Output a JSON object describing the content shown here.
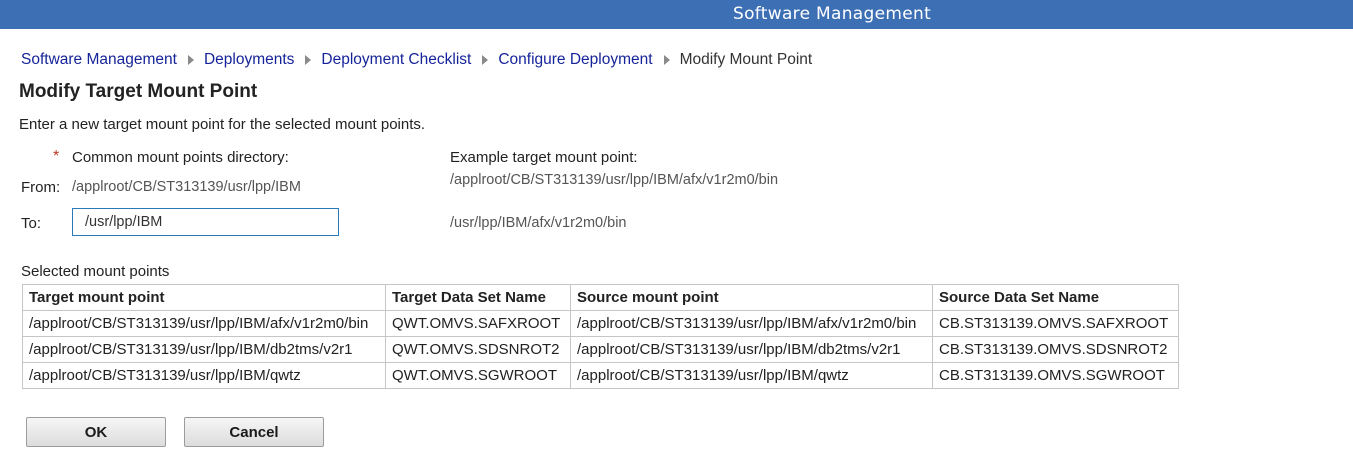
{
  "header": {
    "title": "Software Management"
  },
  "breadcrumb": {
    "links": [
      "Software Management",
      "Deployments",
      "Deployment Checklist",
      "Configure Deployment"
    ],
    "current": "Modify Mount Point"
  },
  "page": {
    "title": "Modify Target Mount Point",
    "instructions": "Enter a new target mount point for the selected mount points."
  },
  "form": {
    "required_marker": "*",
    "common_label": "Common mount points directory:",
    "from_label": "From:",
    "from_value": "/applroot/CB/ST313139/usr/lpp/IBM",
    "to_label": "To:",
    "to_value": "/usr/lpp/IBM",
    "example_label": "Example target mount point:",
    "example_from": "/applroot/CB/ST313139/usr/lpp/IBM/afx/v1r2m0/bin",
    "example_to": "/usr/lpp/IBM/afx/v1r2m0/bin"
  },
  "table": {
    "caption": "Selected mount points",
    "columns": [
      "Target mount point",
      "Target Data Set Name",
      "Source mount point",
      "Source Data Set Name"
    ],
    "rows": [
      [
        "/applroot/CB/ST313139/usr/lpp/IBM/afx/v1r2m0/bin",
        "QWT.OMVS.SAFXROOT",
        "/applroot/CB/ST313139/usr/lpp/IBM/afx/v1r2m0/bin",
        "CB.ST313139.OMVS.SAFXROOT"
      ],
      [
        "/applroot/CB/ST313139/usr/lpp/IBM/db2tms/v2r1",
        "QWT.OMVS.SDSNROT2",
        "/applroot/CB/ST313139/usr/lpp/IBM/db2tms/v2r1",
        "CB.ST313139.OMVS.SDSNROT2"
      ],
      [
        "/applroot/CB/ST313139/usr/lpp/IBM/qwtz",
        "QWT.OMVS.SGWROOT",
        "/applroot/CB/ST313139/usr/lpp/IBM/qwtz",
        "CB.ST313139.OMVS.SGWROOT"
      ]
    ]
  },
  "buttons": {
    "ok": "OK",
    "cancel": "Cancel"
  }
}
